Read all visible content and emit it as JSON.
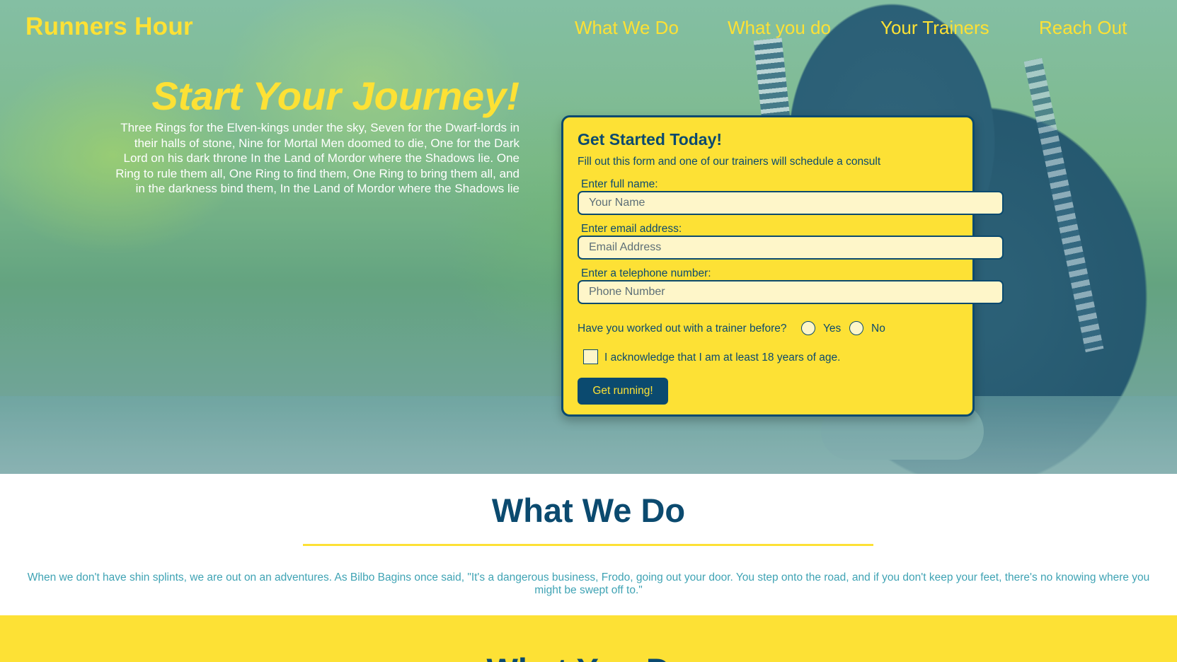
{
  "header": {
    "brand": "Runners Hour",
    "nav": [
      "What We Do",
      "What you do",
      "Your Trainers",
      "Reach Out"
    ]
  },
  "hero": {
    "title": "Start Your Journey!",
    "text": "Three Rings for the Elven-kings under the sky, Seven for the Dwarf-lords in their halls of stone, Nine for Mortal Men doomed to die, One for the Dark Lord on his dark throne In the Land of Mordor where the Shadows lie. One Ring to rule them all, One Ring to find them, One Ring to bring them all, and in the darkness bind them, In the Land of Mordor where the Shadows lie"
  },
  "form": {
    "title": "Get Started Today!",
    "subtitle": "Fill out this form and one of our trainers will schedule a consult",
    "name_label": "Enter full name:",
    "name_placeholder": "Your Name",
    "email_label": "Enter email address:",
    "email_placeholder": "Email Address",
    "phone_label": "Enter a telephone number:",
    "phone_placeholder": "Phone Number",
    "trainer_question": "Have you worked out with a trainer before?",
    "option_yes": "Yes",
    "option_no": "No",
    "age_ack": "I acknowledge that I am at least 18 years of age.",
    "submit": "Get running!"
  },
  "what_we_do": {
    "title": "What We Do",
    "text": "When we don't have shin splints, we are out on an adventures. As Bilbo Bagins once said, \"It's a dangerous business, Frodo, going out your door. You step onto the road, and if you don't keep your feet, there's no knowing where you might be swept off to.\""
  },
  "what_you_do": {
    "title": "What You Do"
  },
  "colors": {
    "accent_yellow": "#fde135",
    "navy": "#0b4a6f",
    "teal_text": "#3fa3b4"
  }
}
